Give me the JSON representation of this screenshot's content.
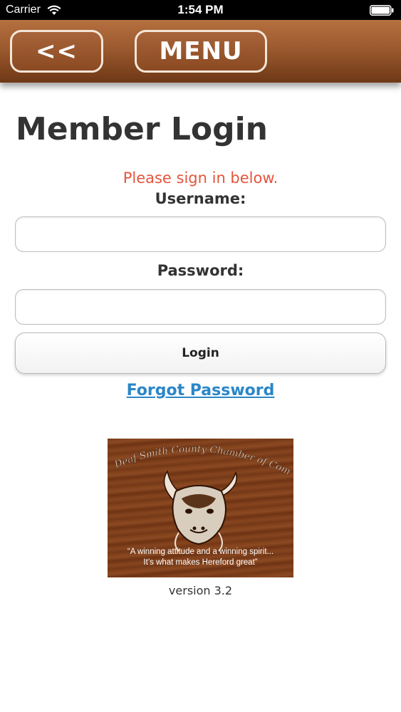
{
  "status_bar": {
    "carrier": "Carrier",
    "time": "1:54 PM"
  },
  "nav": {
    "back_label": "<<",
    "menu_label": "MENU"
  },
  "main": {
    "title": "Member Login",
    "prompt": "Please sign in below.",
    "username_label": "Username:",
    "username_value": "",
    "password_label": "Password:",
    "password_value": "",
    "login_label": "Login",
    "forgot_label": "Forgot Password"
  },
  "logo": {
    "org_name": "Deaf Smith County Chamber of Commerce",
    "quote_line1": "“A winning attitude and a winning spirit...",
    "quote_line2": "It’s what makes Hereford great”"
  },
  "footer": {
    "version": "version 3.2"
  },
  "colors": {
    "nav_brown": "#9c5a2f",
    "prompt_red": "#e4553c",
    "link_blue": "#2a86c8"
  }
}
